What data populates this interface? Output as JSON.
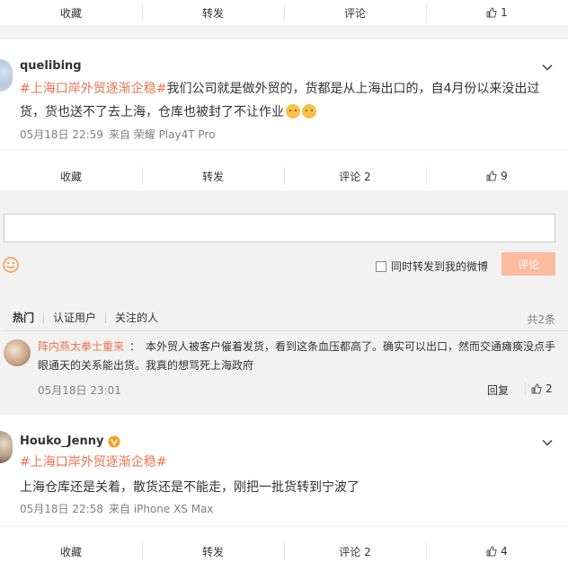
{
  "top_actions": {
    "collect": "收藏",
    "repost": "转发",
    "comment": "评论",
    "like": "1"
  },
  "post1": {
    "username": "quelibing",
    "tag": "#上海口岸外贸逐渐企稳#",
    "text": "我们公司就是做外贸的，货都是从上海出口的，自4月份以来没出过货，货也送不了去上海，仓库也被封了不让作业",
    "time": "05月18日 22:59",
    "source": "来自 荣耀 Play4T Pro",
    "actions": {
      "collect": "收藏",
      "repost": "转发",
      "comment": "评论 2",
      "like": "9"
    }
  },
  "comment_box": {
    "placeholder": "",
    "also_repost": "同时转发到我的微博",
    "submit": "评论"
  },
  "comments_section": {
    "tabs": [
      "热门",
      "认证用户",
      "关注的人"
    ],
    "total": "共2条",
    "items": [
      {
        "user": "阵内燕太拳士重来",
        "sep": "：",
        "text": "本外贸人被客户催着发货，看到这条血压都高了。确实可以出口，然而交通瘫痪没点手眼通天的关系能出货。我真的想骂死上海政府",
        "time": "05月18日 23:01",
        "reply": "回复",
        "like": "2"
      }
    ]
  },
  "post2": {
    "username": "Houko_Jenny",
    "tag": "#上海口岸外贸逐渐企稳#",
    "text": "上海仓库还是关着，散货还是不能走，刚把一批货转到宁波了",
    "time": "05月18日 22:58",
    "source": "来自 iPhone XS Max",
    "actions": {
      "collect": "收藏",
      "repost": "转发",
      "comment": "评论 2",
      "like": "4"
    }
  },
  "colors": {
    "accent": "#eb7350",
    "submit_bg": "#fbbb9f",
    "verified": "#f7a11a"
  }
}
